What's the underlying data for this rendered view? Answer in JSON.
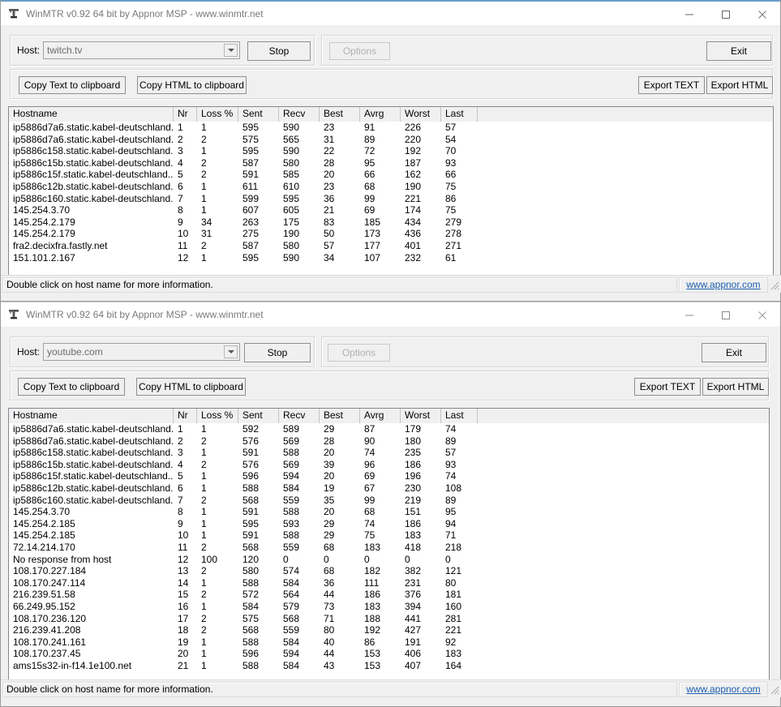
{
  "windows": [
    {
      "id": "win1",
      "title": "WinMTR v0.92 64 bit by Appnor MSP - www.winmtr.net",
      "icon": "winmtr-app-icon",
      "controls": {
        "minimize": "minimize-icon",
        "maximize": "maximize-icon",
        "close": "close-icon"
      },
      "host_label": "Host:",
      "host_value": "twitch.tv",
      "start_stop_label": "Stop",
      "options_label": "Options",
      "exit_label": "Exit",
      "copy_text_label": "Copy Text to clipboard",
      "copy_html_label": "Copy HTML to clipboard",
      "export_text_label": "Export TEXT",
      "export_html_label": "Export HTML",
      "columns": [
        "Hostname",
        "Nr",
        "Loss %",
        "Sent",
        "Recv",
        "Best",
        "Avrg",
        "Worst",
        "Last"
      ],
      "rows": [
        [
          "ip5886d7a6.static.kabel-deutschland...",
          "1",
          "1",
          "595",
          "590",
          "23",
          "91",
          "226",
          "57"
        ],
        [
          "ip5886d7a6.static.kabel-deutschland...",
          "2",
          "2",
          "575",
          "565",
          "31",
          "89",
          "220",
          "54"
        ],
        [
          "ip5886c158.static.kabel-deutschland...",
          "3",
          "1",
          "595",
          "590",
          "22",
          "72",
          "192",
          "70"
        ],
        [
          "ip5886c15b.static.kabel-deutschland...",
          "4",
          "2",
          "587",
          "580",
          "28",
          "95",
          "187",
          "93"
        ],
        [
          "ip5886c15f.static.kabel-deutschland....",
          "5",
          "2",
          "591",
          "585",
          "20",
          "66",
          "162",
          "66"
        ],
        [
          "ip5886c12b.static.kabel-deutschland...",
          "6",
          "1",
          "611",
          "610",
          "23",
          "68",
          "190",
          "75"
        ],
        [
          "ip5886c160.static.kabel-deutschland...",
          "7",
          "1",
          "599",
          "595",
          "36",
          "99",
          "221",
          "86"
        ],
        [
          "145.254.3.70",
          "8",
          "1",
          "607",
          "605",
          "21",
          "69",
          "174",
          "75"
        ],
        [
          "145.254.2.179",
          "9",
          "34",
          "263",
          "175",
          "83",
          "185",
          "434",
          "279"
        ],
        [
          "145.254.2.179",
          "10",
          "31",
          "275",
          "190",
          "50",
          "173",
          "436",
          "278"
        ],
        [
          "fra2.decixfra.fastly.net",
          "11",
          "2",
          "587",
          "580",
          "57",
          "177",
          "401",
          "271"
        ],
        [
          "151.101.2.167",
          "12",
          "1",
          "595",
          "590",
          "34",
          "107",
          "232",
          "61"
        ]
      ],
      "status_text": "Double click on host name for more information.",
      "status_link": "www.appnor.com"
    },
    {
      "id": "win2",
      "title": "WinMTR v0.92 64 bit by Appnor MSP - www.winmtr.net",
      "icon": "winmtr-app-icon",
      "controls": {
        "minimize": "minimize-icon",
        "maximize": "maximize-icon",
        "close": "close-icon"
      },
      "host_label": "Host:",
      "host_value": "youtube.com",
      "start_stop_label": "Stop",
      "options_label": "Options",
      "exit_label": "Exit",
      "copy_text_label": "Copy Text to clipboard",
      "copy_html_label": "Copy HTML to clipboard",
      "export_text_label": "Export TEXT",
      "export_html_label": "Export HTML",
      "columns": [
        "Hostname",
        "Nr",
        "Loss %",
        "Sent",
        "Recv",
        "Best",
        "Avrg",
        "Worst",
        "Last"
      ],
      "rows": [
        [
          "ip5886d7a6.static.kabel-deutschland...",
          "1",
          "1",
          "592",
          "589",
          "29",
          "87",
          "179",
          "74"
        ],
        [
          "ip5886d7a6.static.kabel-deutschland...",
          "2",
          "2",
          "576",
          "569",
          "28",
          "90",
          "180",
          "89"
        ],
        [
          "ip5886c158.static.kabel-deutschland...",
          "3",
          "1",
          "591",
          "588",
          "20",
          "74",
          "235",
          "57"
        ],
        [
          "ip5886c15b.static.kabel-deutschland...",
          "4",
          "2",
          "576",
          "569",
          "39",
          "96",
          "186",
          "93"
        ],
        [
          "ip5886c15f.static.kabel-deutschland....",
          "5",
          "1",
          "596",
          "594",
          "20",
          "69",
          "196",
          "74"
        ],
        [
          "ip5886c12b.static.kabel-deutschland...",
          "6",
          "1",
          "588",
          "584",
          "19",
          "67",
          "230",
          "108"
        ],
        [
          "ip5886c160.static.kabel-deutschland...",
          "7",
          "2",
          "568",
          "559",
          "35",
          "99",
          "219",
          "89"
        ],
        [
          "145.254.3.70",
          "8",
          "1",
          "591",
          "588",
          "20",
          "68",
          "151",
          "95"
        ],
        [
          "145.254.2.185",
          "9",
          "1",
          "595",
          "593",
          "29",
          "74",
          "186",
          "94"
        ],
        [
          "145.254.2.185",
          "10",
          "1",
          "591",
          "588",
          "29",
          "75",
          "183",
          "71"
        ],
        [
          "72.14.214.170",
          "11",
          "2",
          "568",
          "559",
          "68",
          "183",
          "418",
          "218"
        ],
        [
          "No response from host",
          "12",
          "100",
          "120",
          "0",
          "0",
          "0",
          "0",
          "0"
        ],
        [
          "108.170.227.184",
          "13",
          "2",
          "580",
          "574",
          "68",
          "182",
          "382",
          "121"
        ],
        [
          "108.170.247.114",
          "14",
          "1",
          "588",
          "584",
          "36",
          "111",
          "231",
          "80"
        ],
        [
          "216.239.51.58",
          "15",
          "2",
          "572",
          "564",
          "44",
          "186",
          "376",
          "181"
        ],
        [
          "66.249.95.152",
          "16",
          "1",
          "584",
          "579",
          "73",
          "183",
          "394",
          "160"
        ],
        [
          "108.170.236.120",
          "17",
          "2",
          "575",
          "568",
          "71",
          "188",
          "441",
          "281"
        ],
        [
          "216.239.41.208",
          "18",
          "2",
          "568",
          "559",
          "80",
          "192",
          "427",
          "221"
        ],
        [
          "108.170.241.161",
          "19",
          "1",
          "588",
          "584",
          "40",
          "86",
          "191",
          "92"
        ],
        [
          "108.170.237.45",
          "20",
          "1",
          "596",
          "594",
          "44",
          "153",
          "406",
          "183"
        ],
        [
          "ams15s32-in-f14.1e100.net",
          "21",
          "1",
          "588",
          "584",
          "43",
          "153",
          "407",
          "164"
        ]
      ],
      "status_text": "Double click on host name for more information.",
      "status_link": "www.appnor.com"
    }
  ],
  "colors": {
    "window_bg": "#f0f0f0",
    "titlebar_accent": "#6a9cc4",
    "link": "#1c5fb0",
    "list_bg": "#ffffff",
    "disabled_text": "#b0b0b0",
    "title_text": "#7a7a7a"
  }
}
